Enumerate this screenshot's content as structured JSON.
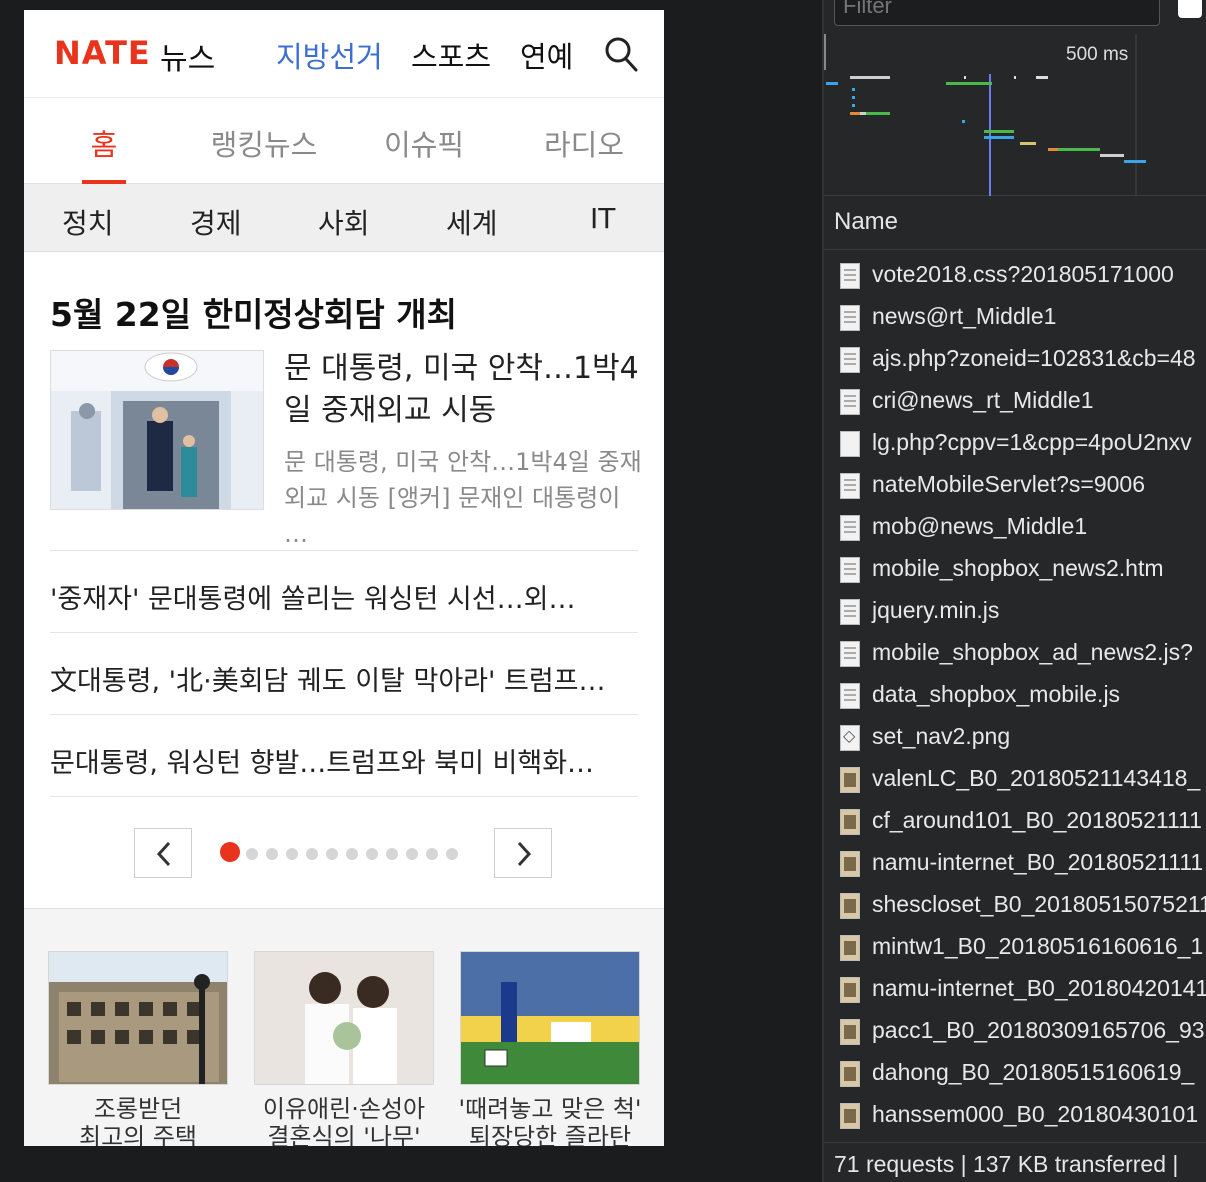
{
  "header": {
    "logo": "NATE",
    "logo_sub": "뉴스",
    "nav": [
      "지방선거",
      "스포츠",
      "연예"
    ]
  },
  "tabs": [
    "홈",
    "랭킹뉴스",
    "이슈픽",
    "라디오"
  ],
  "categories": [
    "정치",
    "경제",
    "사회",
    "세계",
    "IT"
  ],
  "headline": "5월 22일 한미정상회담 개최",
  "feature": {
    "title": "문 대통령, 미국 안착…1박4일 중재외교 시동",
    "desc": "문 대통령, 미국 안착…1박4일 중재외교 시동 [앵커] 문재인 대통령이 …"
  },
  "news_list": [
    "'중재자' 문대통령에 쏠리는 워싱턴 시선…외…",
    "文대통령, '北·美회담 궤도 이탈 막아라' 트럼프…",
    "문대통령, 워싱턴 향발…트럼프와 북미 비핵화…"
  ],
  "pager": {
    "total_dots": 12,
    "active_index": 0
  },
  "thumbs": [
    {
      "line1": "조롱받던",
      "line2": "최고의 주택"
    },
    {
      "line1": "이유애린·손성아",
      "line2": "결혼식의 '나무'"
    },
    {
      "line1": "'때려놓고 맞은 척'",
      "line2": "퇴장당한 즐라탄"
    }
  ],
  "devtools": {
    "filter_placeholder": "Filter",
    "timeline_label": "500 ms",
    "name_header": "Name",
    "requests": [
      {
        "name": "vote2018.css?201805171000",
        "icon": "doc"
      },
      {
        "name": "news@rt_Middle1",
        "icon": "doc"
      },
      {
        "name": "ajs.php?zoneid=102831&cb=48",
        "icon": "doc"
      },
      {
        "name": "cri@news_rt_Middle1",
        "icon": "doc"
      },
      {
        "name": "lg.php?cppv=1&cpp=4poU2nxv",
        "icon": "blank"
      },
      {
        "name": "nateMobileServlet?s=9006",
        "icon": "doc"
      },
      {
        "name": "mob@news_Middle1",
        "icon": "doc"
      },
      {
        "name": "mobile_shopbox_news2.htm",
        "icon": "doc"
      },
      {
        "name": "jquery.min.js",
        "icon": "doc"
      },
      {
        "name": "mobile_shopbox_ad_news2.js?",
        "icon": "doc"
      },
      {
        "name": "data_shopbox_mobile.js",
        "icon": "doc"
      },
      {
        "name": "set_nav2.png",
        "icon": "gem"
      },
      {
        "name": "valenLC_B0_20180521143418_",
        "icon": "img"
      },
      {
        "name": "cf_around101_B0_20180521111",
        "icon": "img"
      },
      {
        "name": "namu-internet_B0_20180521111",
        "icon": "img"
      },
      {
        "name": "shescloset_B0_20180515075211",
        "icon": "img"
      },
      {
        "name": "mintw1_B0_20180516160616_1",
        "icon": "img"
      },
      {
        "name": "namu-internet_B0_20180420141",
        "icon": "img"
      },
      {
        "name": "pacc1_B0_20180309165706_93",
        "icon": "img"
      },
      {
        "name": "dahong_B0_20180515160619_",
        "icon": "img"
      },
      {
        "name": "hanssem000_B0_20180430101",
        "icon": "img"
      }
    ],
    "status": "71 requests | 137 KB transferred | "
  }
}
